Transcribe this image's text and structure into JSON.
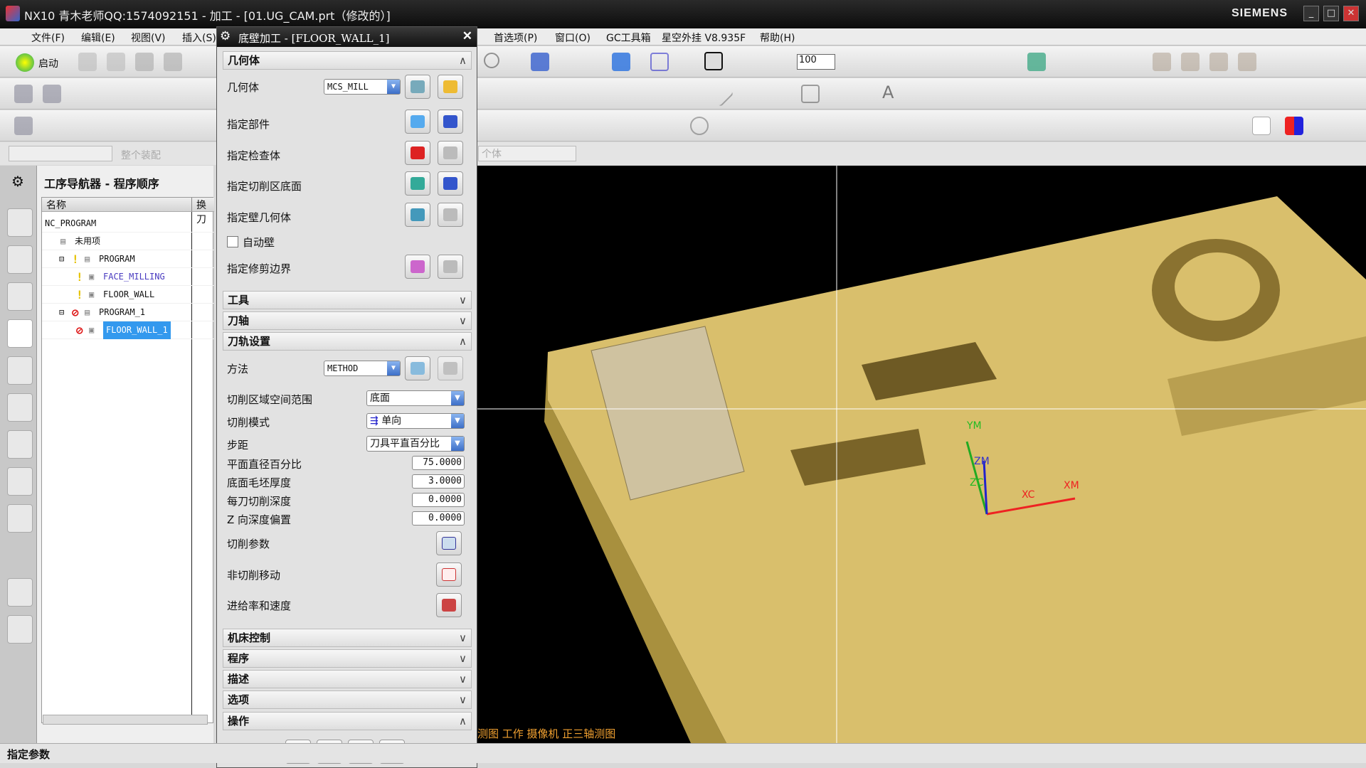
{
  "window": {
    "title": "NX10 青木老师QQ:1574092151 - 加工 - [01.UG_CAM.prt（修改的）]",
    "brand": "SIEMENS",
    "min": "_",
    "max": "□",
    "close": "✕"
  },
  "menubar": {
    "left": [
      "文件(F)",
      "编辑(E)",
      "视图(V)",
      "插入(S)"
    ],
    "right": [
      "首选项(P)",
      "窗口(O)",
      "GC工具箱",
      "星空外挂 V8.935F",
      "帮助(H)"
    ]
  },
  "toolbar": {
    "start_label": "启动",
    "zoom_value": "100",
    "filter_placeholder": "整个装配",
    "filter2": "个体"
  },
  "navigator": {
    "title": "工序导航器 - 程序顺序",
    "columns": [
      "名称",
      "换刀"
    ],
    "rows": [
      {
        "label": "NC_PROGRAM",
        "level": 0
      },
      {
        "label": "未用项",
        "level": 1
      },
      {
        "label": "PROGRAM",
        "level": 1,
        "expand": "−",
        "status": "warning"
      },
      {
        "label": "FACE_MILLING",
        "level": 2,
        "status": "warning",
        "color": "#4a3cc0"
      },
      {
        "label": "FLOOR_WALL",
        "level": 2,
        "status": "warning"
      },
      {
        "label": "PROGRAM_1",
        "level": 1,
        "expand": "−",
        "status": "prohibited"
      },
      {
        "label": "FLOOR_WALL_1",
        "level": 2,
        "status": "prohibited",
        "selected": true
      }
    ]
  },
  "dialog": {
    "title": "底壁加工 - [FLOOR_WALL_1]",
    "close": "✕",
    "geometry": {
      "header": "几何体",
      "geometry_label": "几何体",
      "geometry_value": "MCS_MILL",
      "part": "指定部件",
      "check": "指定检查体",
      "floor": "指定切削区底面",
      "wall": "指定壁几何体",
      "auto_wall": "自动壁",
      "auto_wall_checked": false,
      "trim": "指定修剪边界"
    },
    "tool": "工具",
    "axis": "刀轴",
    "path": {
      "header": "刀轨设置",
      "method_label": "方法",
      "method_value": "METHOD",
      "extent_label": "切削区域空间范围",
      "extent_value": "底面",
      "pattern_label": "切削模式",
      "pattern_value": "单向",
      "stepover_label": "步距",
      "stepover_value": "刀具平直百分比",
      "percent_label": "平面直径百分比",
      "percent_value": "75.0000",
      "floor_stock_label": "底面毛坯厚度",
      "floor_stock_value": "3.0000",
      "depth_label": "每刀切削深度",
      "depth_value": "0.0000",
      "zoffset_label": "Z 向深度偏置",
      "zoffset_value": "0.0000",
      "cut_params": "切削参数",
      "non_cut": "非切削移动",
      "feeds": "进给率和速度"
    },
    "machine": "机床控制",
    "program": "程序",
    "description": "描述",
    "options": "选项",
    "actions": "操作"
  },
  "viewport": {
    "view_label": "测图 工作 摄像机 正三轴测图",
    "axes": [
      "YM",
      "ZM",
      "ZC",
      "XC",
      "XM"
    ],
    "model_color": "#e0c878",
    "bg": "#000000"
  },
  "status": {
    "text": "指定参数"
  }
}
